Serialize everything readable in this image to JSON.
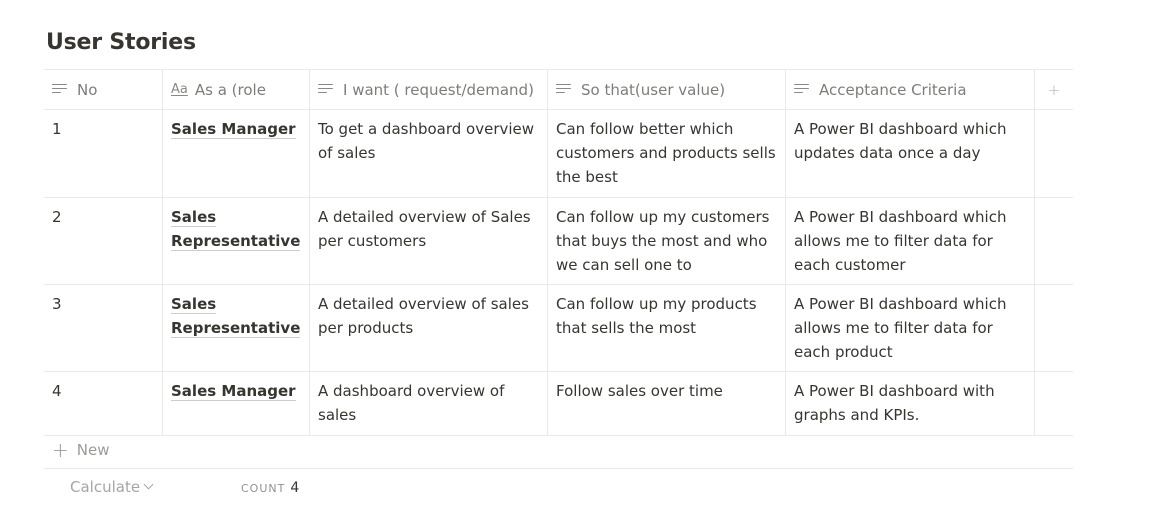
{
  "page": {
    "title": "User Stories"
  },
  "table": {
    "columns": [
      {
        "label": "No",
        "icon": "text-lines-icon"
      },
      {
        "label": "As a (role",
        "icon": "title-aa-icon"
      },
      {
        "label": "I want ( request/demand)",
        "icon": "text-lines-icon"
      },
      {
        "label": "So that(user value)",
        "icon": "text-lines-icon"
      },
      {
        "label": "Acceptance Criteria",
        "icon": "text-lines-icon"
      }
    ],
    "add_column_icon": "+",
    "rows": [
      {
        "no": "1",
        "role": "Sales Manager",
        "want": "To get a dashboard overview of sales",
        "so_that": "Can follow better which customers and products sells the best",
        "criteria": "A Power BI dashboard which updates data once a day"
      },
      {
        "no": "2",
        "role": "Sales Representative",
        "want": "A detailed overview of Sales per customers",
        "so_that": "Can follow up my customers that buys the most and who we can sell one to",
        "criteria": "A Power BI dashboard which allows me to filter data for each customer"
      },
      {
        "no": "3",
        "role": "Sales Representative",
        "want": "A detailed overview of sales per products",
        "so_that": "Can follow up my products that sells the most",
        "criteria": "A Power BI dashboard which allows me to filter data for each product"
      },
      {
        "no": "4",
        "role": "Sales Manager",
        "want": "A dashboard overview of sales",
        "so_that": "Follow sales over time",
        "criteria": "A Power BI dashboard with graphs and KPIs."
      }
    ]
  },
  "footer": {
    "new_plus": "+",
    "new_label": "New",
    "calculate_label": "Calculate",
    "count_label": "COUNT",
    "count_value": "4"
  },
  "colors": {
    "text": "#37352f",
    "border": "#e9e9e7"
  }
}
